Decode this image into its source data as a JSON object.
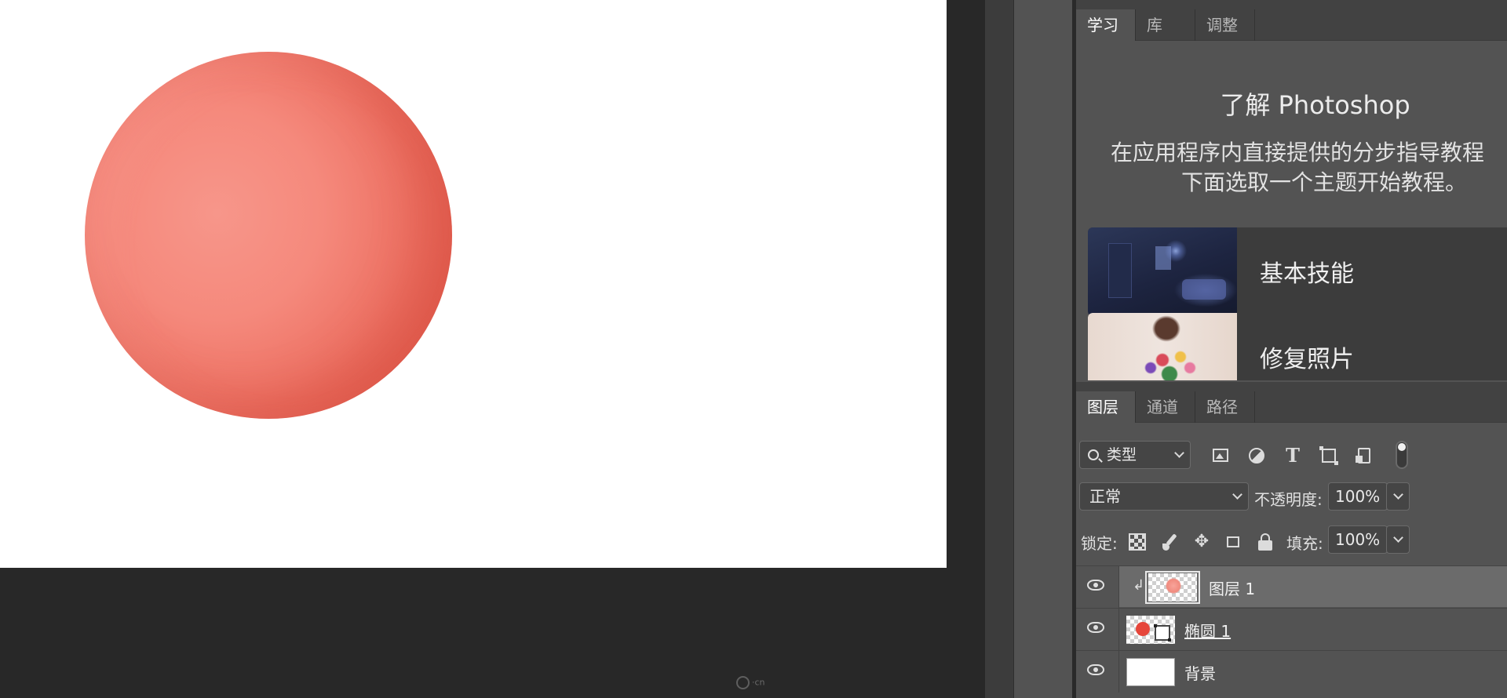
{
  "learn_panel": {
    "tabs": [
      "学习",
      "库",
      "调整"
    ],
    "active_tab": 0,
    "title": "了解 Photoshop",
    "description_line1": "在应用程序内直接提供的分步指导教程",
    "description_line2": "下面选取一个主题开始教程。",
    "lessons": [
      "基本技能",
      "修复照片"
    ]
  },
  "layers_panel": {
    "tabs": [
      "图层",
      "通道",
      "路径"
    ],
    "active_tab": 0,
    "filter": {
      "value": "类型",
      "icons": [
        "image-filter-icon",
        "adjustment-filter-icon",
        "type-filter-icon",
        "shape-filter-icon",
        "smart-object-filter-icon"
      ]
    },
    "blend_mode": "正常",
    "opacity_label": "不透明度:",
    "opacity_value": "100%",
    "lock_label": "锁定:",
    "fill_label": "填充:",
    "fill_value": "100%",
    "layers": [
      {
        "name": "图层 1",
        "selected": true,
        "clipped": true
      },
      {
        "name": "椭圆 1",
        "selected": false,
        "shape": true
      },
      {
        "name": "背景",
        "selected": false
      }
    ]
  },
  "canvas": {
    "background_color": "#ffffff",
    "sphere_color": "#f5897c",
    "watermark_text": "·cn"
  }
}
